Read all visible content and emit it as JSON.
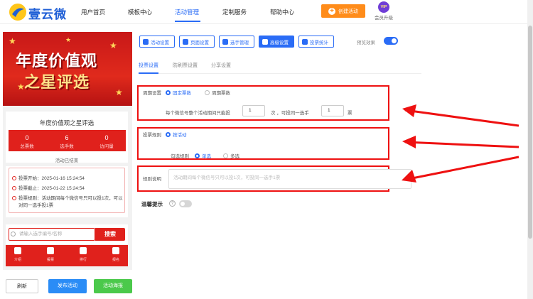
{
  "header": {
    "brand": "壹云微",
    "nav": [
      "用户首页",
      "模板中心",
      "活动管理",
      "定制服务",
      "帮助中心"
    ],
    "active_nav": "活动管理",
    "create_button": "创建活动",
    "vip_badge": "VIP",
    "vip_label": "会员升级"
  },
  "preview": {
    "banner_line1": "年度价值观",
    "banner_line2": "之星评选",
    "activity_title": "年度价值观之星评选",
    "stats": [
      {
        "value": "0",
        "label": "总票数"
      },
      {
        "value": "6",
        "label": "选手数"
      },
      {
        "value": "0",
        "label": "访问量"
      }
    ],
    "status": "活动已结束",
    "info": [
      "投票开始：2025-01-16 15:24:54",
      "投票截止：2025-01-22 15:24:54",
      "投票规则：活动期间每个微信号只可以投1次，可以",
      "对同一选手投1票"
    ],
    "search_placeholder": "请输入选手编号/名称",
    "search_button": "搜索",
    "tabs": [
      "介绍",
      "投票",
      "排行",
      "报名"
    ],
    "active_tab": "投票"
  },
  "bottom_buttons": {
    "refresh": "刷新",
    "publish": "发布活动",
    "poster": "活动海报"
  },
  "toolbar": {
    "buttons": [
      "活动设置",
      "页面设置",
      "选手管理",
      "高级设置",
      "投票统计"
    ],
    "active": "高级设置",
    "preview_label": "预览效果",
    "preview_on": true
  },
  "subtabs": [
    "投票设置",
    "防刷票设置",
    "分享设置"
  ],
  "active_subtab": "投票设置",
  "cycle": {
    "label": "周期设置",
    "option_fixed": "固定票数",
    "option_periodic": "周期票数",
    "selected": "固定票数",
    "sentence_a": "每个微信号整个活动期间只能投",
    "count_total": "1",
    "sentence_b": "次 ，可投同一选手",
    "count_same": "1",
    "sentence_c": "票"
  },
  "rule": {
    "label": "投票规则",
    "option": "按活动",
    "check_label": "勾选规则",
    "single": "单选",
    "multi": "多选",
    "selected": "单选"
  },
  "explain": {
    "label": "规则说明",
    "placeholder": "活动期间每个微信号只可以投1次，可投同一选手1票"
  },
  "tip": {
    "label": "温馨提示",
    "enabled": false
  },
  "colors": {
    "accent": "#2a6cf6",
    "annotation": "#ee1111",
    "preview_red": "#e0211c",
    "create": "#ff8c1a",
    "publish": "#2a8cf6",
    "poster": "#4bc94b"
  }
}
